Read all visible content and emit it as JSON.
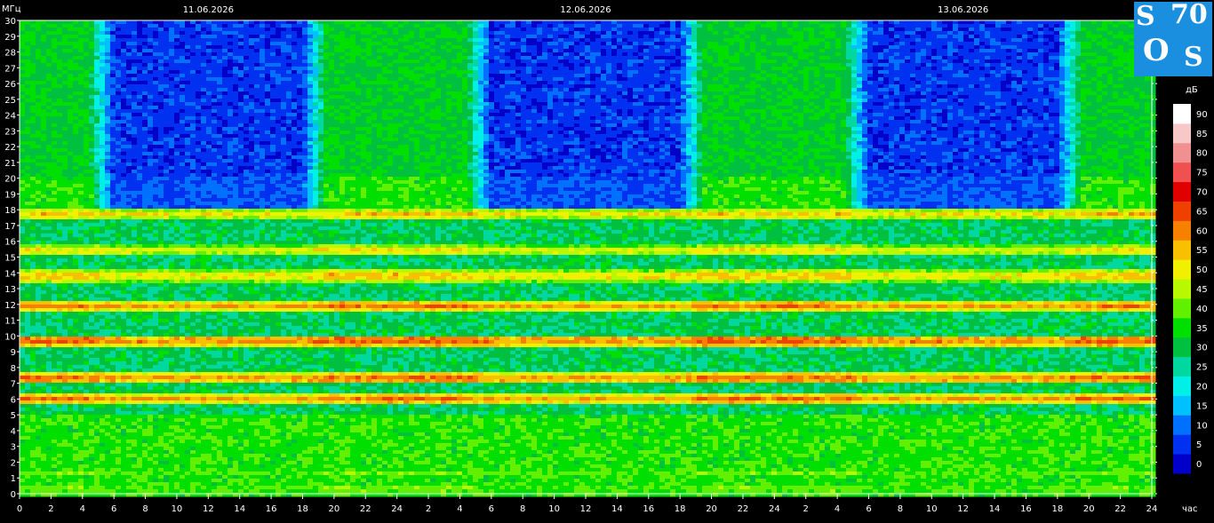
{
  "chart_data": {
    "type": "heatmap",
    "title": "",
    "ylabel": "МГц",
    "xlabel": "час",
    "colorbar_label": "дБ",
    "ylim": [
      0,
      30
    ],
    "y_ticks": [
      0,
      1,
      2,
      3,
      4,
      5,
      6,
      7,
      8,
      9,
      10,
      11,
      12,
      13,
      14,
      15,
      16,
      17,
      18,
      19,
      20,
      21,
      22,
      23,
      24,
      25,
      26,
      27,
      28,
      29,
      30
    ],
    "x_tick_labels": [
      "0",
      "2",
      "4",
      "6",
      "8",
      "10",
      "12",
      "14",
      "16",
      "18",
      "20",
      "22",
      "24",
      "2",
      "4",
      "6",
      "8",
      "10",
      "12",
      "14",
      "16",
      "18",
      "20",
      "22",
      "24",
      "2",
      "4",
      "6",
      "8",
      "10",
      "12",
      "14",
      "16",
      "18",
      "20",
      "22",
      "24"
    ],
    "dates": [
      "11.06.2026",
      "12.06.2026",
      "13.06.2026"
    ],
    "hours_span": [
      0,
      72
    ],
    "colorbar": {
      "range": [
        0,
        90
      ],
      "ticks": [
        0,
        5,
        10,
        15,
        20,
        25,
        30,
        35,
        40,
        45,
        50,
        55,
        60,
        65,
        70,
        75,
        80,
        85,
        90
      ],
      "colors": [
        "#0000c8",
        "#0030f0",
        "#0070ff",
        "#00c0ff",
        "#00f0e8",
        "#00d8a0",
        "#00c040",
        "#00e000",
        "#60f000",
        "#b8f800",
        "#f0f000",
        "#f8c000",
        "#f88000",
        "#f04000",
        "#e00000",
        "#f05050",
        "#f09090",
        "#f8c8c8",
        "#ffffff"
      ]
    },
    "bands_mhz": [
      {
        "freq": 0.3,
        "level": 48
      },
      {
        "freq": 1.3,
        "level": 45
      },
      {
        "freq": 6.0,
        "level": 66
      },
      {
        "freq": 7.3,
        "level": 68
      },
      {
        "freq": 9.7,
        "level": 70
      },
      {
        "freq": 11.9,
        "level": 66
      },
      {
        "freq": 13.8,
        "level": 62
      },
      {
        "freq": 15.4,
        "level": 58
      },
      {
        "freq": 17.7,
        "level": 60
      }
    ]
  },
  "logo": {
    "chars": [
      "S",
      "70",
      "O",
      "S"
    ]
  }
}
